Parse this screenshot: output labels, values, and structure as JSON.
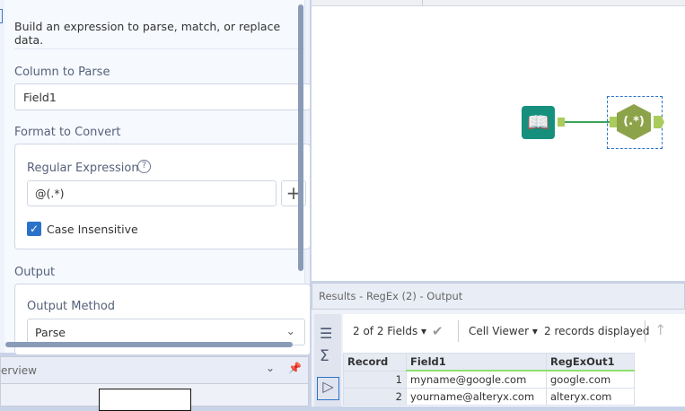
{
  "config": {
    "description": "Build an expression to parse, match, or replace data.",
    "column_label": "Column to Parse",
    "column_value": "Field1",
    "format_label": "Format to Convert",
    "regex_label": "Regular Expression",
    "regex_value": "@(.*)",
    "case_label": "Case Insensitive",
    "case_checked": true,
    "output_label": "Output",
    "output_method_label": "Output Method",
    "output_method_value": "Parse"
  },
  "overview": {
    "title": "erview"
  },
  "canvas": {
    "tools": [
      "input-data",
      "regex"
    ]
  },
  "results": {
    "title": "Results - RegEx (2) - Output",
    "fields": "2 of 2 Fields",
    "cell_viewer": "Cell Viewer",
    "records": "2 records displayed",
    "columns": [
      "Record",
      "Field1",
      "RegExOut1"
    ],
    "rows": [
      [
        "1",
        "myname@google.com",
        "google.com"
      ],
      [
        "2",
        "yourname@alteryx.com",
        "alteryx.com"
      ]
    ]
  }
}
